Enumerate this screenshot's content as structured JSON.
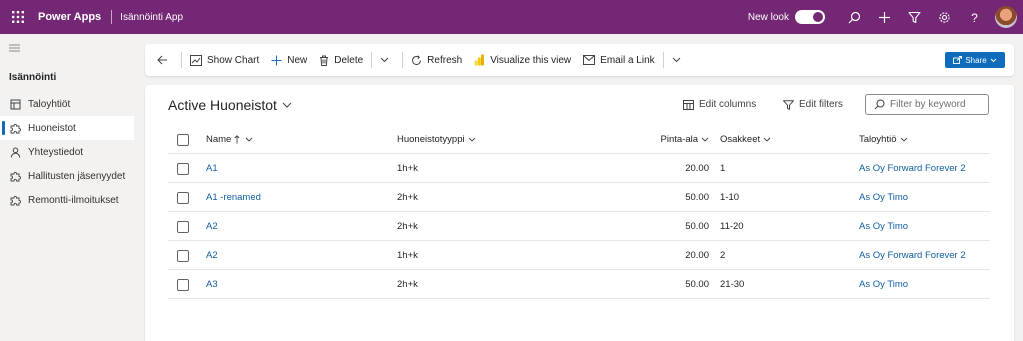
{
  "topbar": {
    "app_name": "Power Apps",
    "app_title": "Isännöinti App",
    "new_look_label": "New look",
    "new_look_enabled": true,
    "brand_color": "#742774"
  },
  "sidebar": {
    "group_title": "Isännöinti",
    "items": [
      {
        "label": "Taloyhtiöt",
        "icon": "building-icon",
        "active": false
      },
      {
        "label": "Huoneistot",
        "icon": "puzzle-icon",
        "active": true
      },
      {
        "label": "Yhteystiedot",
        "icon": "person-icon",
        "active": false
      },
      {
        "label": "Hallitusten jäsenyydet",
        "icon": "puzzle-icon",
        "active": false
      },
      {
        "label": "Remontti-ilmoitukset",
        "icon": "puzzle-icon",
        "active": false
      }
    ]
  },
  "commandbar": {
    "show_chart": "Show Chart",
    "new": "New",
    "delete": "Delete",
    "refresh": "Refresh",
    "visualize": "Visualize this view",
    "email_link": "Email a Link",
    "share": "Share"
  },
  "view": {
    "title": "Active Huoneistot",
    "edit_columns": "Edit columns",
    "edit_filters": "Edit filters",
    "filter_placeholder": "Filter by keyword"
  },
  "table": {
    "columns": {
      "name": "Name",
      "type": "Huoneistotyyppi",
      "area": "Pinta-ala",
      "shares": "Osakkeet",
      "company": "Taloyhtiö"
    },
    "rows": [
      {
        "name": "A1",
        "type": "1h+k",
        "area": "20.00",
        "shares": "1",
        "company": "As Oy Forward Forever 2"
      },
      {
        "name": "A1 -renamed",
        "type": "2h+k",
        "area": "50.00",
        "shares": "1-10",
        "company": "As Oy Timo"
      },
      {
        "name": "A2",
        "type": "2h+k",
        "area": "50.00",
        "shares": "11-20",
        "company": "As Oy Timo"
      },
      {
        "name": "A2",
        "type": "1h+k",
        "area": "20.00",
        "shares": "2",
        "company": "As Oy Forward Forever 2"
      },
      {
        "name": "A3",
        "type": "2h+k",
        "area": "50.00",
        "shares": "21-30",
        "company": "As Oy Timo"
      }
    ]
  }
}
